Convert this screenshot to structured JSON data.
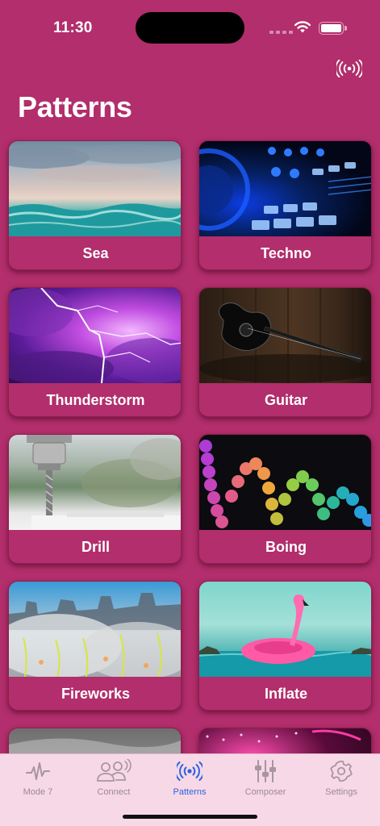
{
  "status_bar": {
    "time": "11:30"
  },
  "header": {
    "title": "Patterns",
    "broadcast_icon": "broadcast-icon"
  },
  "patterns": [
    {
      "label": "Sea",
      "image": "sea"
    },
    {
      "label": "Techno",
      "image": "techno"
    },
    {
      "label": "Thunderstorm",
      "image": "thunderstorm"
    },
    {
      "label": "Guitar",
      "image": "guitar"
    },
    {
      "label": "Drill",
      "image": "drill"
    },
    {
      "label": "Boing",
      "image": "boing"
    },
    {
      "label": "Fireworks",
      "image": "fireworks"
    },
    {
      "label": "Inflate",
      "image": "inflate"
    }
  ],
  "tabs": [
    {
      "label": "Mode 7",
      "icon": "waveform-icon",
      "active": false
    },
    {
      "label": "Connect",
      "icon": "people-broadcast-icon",
      "active": false
    },
    {
      "label": "Patterns",
      "icon": "broadcast-icon",
      "active": true
    },
    {
      "label": "Composer",
      "icon": "sliders-icon",
      "active": false
    },
    {
      "label": "Settings",
      "icon": "gear-icon",
      "active": false
    }
  ],
  "colors": {
    "background": "#b22e6c",
    "tab_bar": "#f7d8e6",
    "tab_active": "#2d63e0",
    "tab_inactive": "#9c8a92"
  }
}
